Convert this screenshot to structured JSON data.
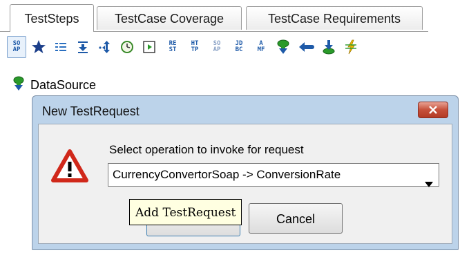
{
  "tabs": [
    {
      "label": "TestSteps",
      "active": true
    },
    {
      "label": "TestCase Coverage",
      "active": false
    },
    {
      "label": "TestCase Requirements",
      "active": false
    }
  ],
  "toolbar": {
    "icons": [
      {
        "name": "soap-request-icon",
        "text": [
          "SO",
          "AP"
        ]
      },
      {
        "name": "star-icon"
      },
      {
        "name": "properties-icon"
      },
      {
        "name": "property-transfer-icon"
      },
      {
        "name": "conditional-goto-icon"
      },
      {
        "name": "delay-icon"
      },
      {
        "name": "run-testcase-icon"
      },
      {
        "name": "rest-request-icon",
        "text": [
          "RE",
          "ST"
        ]
      },
      {
        "name": "http-request-icon",
        "text": [
          "HT",
          "TP"
        ]
      },
      {
        "name": "soap-mock-response-icon",
        "text": [
          "SO",
          "AP"
        ]
      },
      {
        "name": "jdbc-request-icon",
        "text": [
          "JD",
          "BC"
        ]
      },
      {
        "name": "amf-request-icon",
        "text": [
          "A",
          "MF"
        ]
      },
      {
        "name": "datasource-icon"
      },
      {
        "name": "datasource-loop-icon"
      },
      {
        "name": "datasink-icon"
      },
      {
        "name": "manual-teststep-icon"
      }
    ]
  },
  "tree": {
    "datasource_label": "DataSource"
  },
  "dialog": {
    "title": "New TestRequest",
    "prompt": "Select operation to invoke for request",
    "operation_value": "CurrencyConvertorSoap -> ConversionRate",
    "ok_label": "",
    "cancel_label": "Cancel",
    "tooltip": "Add TestRequest"
  },
  "colors": {
    "dialog_frame": "#bcd3ea",
    "close_button": "#c6503a",
    "warning": "#d0281a",
    "tooltip_bg": "#ffffe1"
  }
}
